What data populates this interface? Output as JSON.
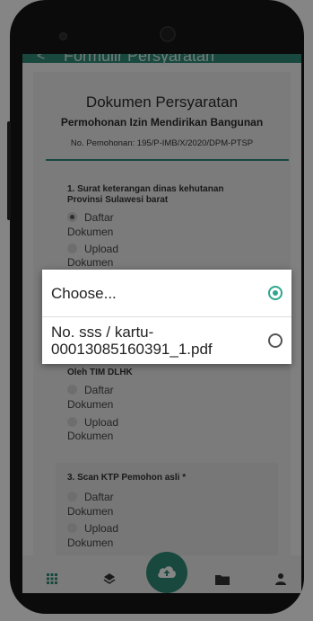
{
  "appbar": {
    "title": "Formulir Persyaratan"
  },
  "document": {
    "title": "Dokumen Persyaratan",
    "subtitle": "Permohonan Izin Mendirikan Bangunan",
    "number": "No. Pemohonan: 195/P-IMB/X/2020/DPM-PTSP"
  },
  "requirements": [
    {
      "title_line1": "1. Surat keterangan dinas kehutanan",
      "title_line2": "Provinsi Sulawesi barat",
      "option1_a": "Daftar",
      "option1_b": "Dokumen",
      "option2_a": "Upload",
      "option2_b": "Dokumen",
      "selected": "option1"
    },
    {
      "title_line1": "Oleh TIM DLHK",
      "option1_a": "Daftar",
      "option1_b": "Dokumen",
      "option2_a": "Upload",
      "option2_b": "Dokumen"
    },
    {
      "title_line1": "3. Scan KTP Pemohon asli *",
      "option1_a": "Daftar",
      "option1_b": "Dokumen",
      "option2_a": "Upload",
      "option2_b": "Dokumen"
    }
  ],
  "dialog": {
    "options": [
      {
        "label": "Choose...",
        "selected": true
      },
      {
        "label_line1": "No. sss / kartu-",
        "label_line2": "00013085160391_1.pdf",
        "selected": false
      }
    ]
  },
  "bottom_nav": {
    "items": [
      {
        "icon": "grid-icon"
      },
      {
        "icon": "layers-icon"
      },
      {
        "icon": "cloud-upload-icon"
      },
      {
        "icon": "folder-icon"
      },
      {
        "icon": "person-icon"
      }
    ]
  },
  "colors": {
    "primary": "#2e8b78",
    "dialog_accent": "#2fa68f"
  }
}
